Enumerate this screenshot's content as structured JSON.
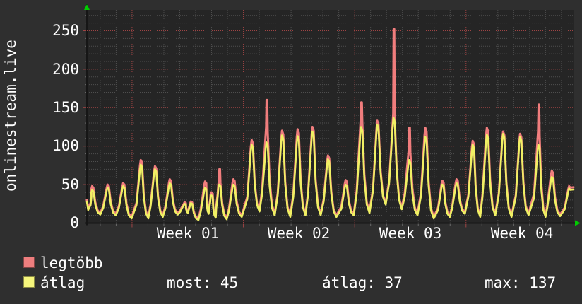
{
  "title": "onlinestream.live",
  "colors": {
    "background": "#2f2f2f",
    "plot_background": "#252525",
    "minor_grid": "#4f4f4f",
    "major_grid": "#a04444",
    "axis": "#161616",
    "arrow": "#00cc00",
    "text": "#ffffff",
    "series_max": "#f07d7d",
    "series_avg": "#f0f064",
    "swatch_max": "#ee7e7e",
    "swatch_avg": "#f6f67c"
  },
  "legend": [
    {
      "label": "legtöbb",
      "color": "#ee7e7e"
    },
    {
      "label": "átlag",
      "color": "#f6f67c"
    }
  ],
  "stats": [
    {
      "label": "most",
      "value": 45,
      "text": "most: 45"
    },
    {
      "label": "átlag",
      "value": 37,
      "text": "átlag: 37"
    },
    {
      "label": "max",
      "value": 137,
      "text": "max: 137"
    }
  ],
  "chart_data": {
    "type": "line",
    "title": "onlinestream.live",
    "grid": "dotted, minor gray every 10 units / 1 day, major red every 50 units / 1 week",
    "legend_position": "bottom-left",
    "x_axis": {
      "unit": "days",
      "span_days": 30.6,
      "tick_labels": [
        "Week 01",
        "Week 02",
        "Week 03",
        "Week 04"
      ],
      "tick_center_days": [
        6.34,
        13.34,
        20.34,
        27.34
      ],
      "week_boundary_days": [
        2.84,
        9.84,
        16.84,
        23.84
      ],
      "day_grid_start": 0.84
    },
    "y_axis": {
      "tick_labels": [
        "0",
        "50",
        "100",
        "150",
        "200",
        "250"
      ],
      "tick_values": [
        0,
        50,
        100,
        150,
        200,
        250
      ],
      "minor_step": 10,
      "ylim": [
        0,
        277
      ]
    },
    "series": [
      {
        "name": "legtöbb",
        "role": "daily maximum",
        "color": "#f07d7d"
      },
      {
        "name": "átlag",
        "role": "daily average",
        "color": "#f0f064"
      }
    ],
    "summary": {
      "most_current": 45,
      "atlag_average": 37,
      "max": 137
    },
    "start": {
      "max": 30,
      "avg": 28,
      "dip_max": 19,
      "dip_avg": 17
    },
    "days": [
      {
        "d": 0.36,
        "max": 48,
        "avg": 43,
        "lo": 13
      },
      {
        "d": 1.33,
        "max": 50,
        "avg": 46,
        "lo": 12
      },
      {
        "d": 2.31,
        "max": 52,
        "avg": 48,
        "lo": 8
      },
      {
        "d": 3.42,
        "max": 82,
        "avg": 76,
        "lo": 8
      },
      {
        "d": 4.31,
        "max": 74,
        "avg": 70,
        "lo": 10
      },
      {
        "d": 5.24,
        "max": 57,
        "avg": 52,
        "lo": 13
      },
      {
        "d": 6.17,
        "max": 27,
        "avg": 25,
        "lo": 15
      },
      {
        "d": 6.57,
        "max": 28,
        "avg": 26,
        "lo": 6
      },
      {
        "d": 7.46,
        "max": 54,
        "avg": 46,
        "lo": 14
      },
      {
        "d": 7.86,
        "max": 40,
        "avg": 36,
        "lo": 9
      },
      {
        "d": 8.35,
        "max": 70,
        "avg": 50,
        "lo": 7,
        "step": 55
      },
      {
        "d": 9.24,
        "max": 57,
        "avg": 50,
        "lo": 10
      },
      {
        "d": 10.39,
        "max": 108,
        "avg": 102,
        "lo": 17
      },
      {
        "d": 11.32,
        "max": 160,
        "avg": 105,
        "lo": 12,
        "step": 125
      },
      {
        "d": 12.3,
        "max": 120,
        "avg": 114,
        "lo": 10
      },
      {
        "d": 13.28,
        "max": 122,
        "avg": 113,
        "lo": 12
      },
      {
        "d": 14.21,
        "max": 125,
        "avg": 119,
        "lo": 12
      },
      {
        "d": 15.19,
        "max": 88,
        "avg": 83,
        "lo": 10
      },
      {
        "d": 16.3,
        "max": 56,
        "avg": 50,
        "lo": 12
      },
      {
        "d": 17.27,
        "max": 157,
        "avg": 125,
        "lo": 15,
        "step": 137
      },
      {
        "d": 18.29,
        "max": 133,
        "avg": 128,
        "lo": 26
      },
      {
        "d": 19.31,
        "max": 252,
        "avg": 137,
        "lo": 20,
        "step": 143
      },
      {
        "d": 20.29,
        "max": 124,
        "avg": 82,
        "lo": 12,
        "step": 97
      },
      {
        "d": 21.31,
        "max": 124,
        "avg": 112,
        "lo": 8
      },
      {
        "d": 22.38,
        "max": 55,
        "avg": 50,
        "lo": 10
      },
      {
        "d": 23.27,
        "max": 57,
        "avg": 52,
        "lo": 14
      },
      {
        "d": 24.29,
        "max": 107,
        "avg": 102,
        "lo": 10
      },
      {
        "d": 25.18,
        "max": 124,
        "avg": 115,
        "lo": 12
      },
      {
        "d": 26.2,
        "max": 119,
        "avg": 116,
        "lo": 10
      },
      {
        "d": 27.27,
        "max": 116,
        "avg": 112,
        "lo": 12
      },
      {
        "d": 28.42,
        "max": 154,
        "avg": 102,
        "lo": 10,
        "step": 119
      },
      {
        "d": 29.26,
        "max": 68,
        "avg": 60,
        "lo": 11
      },
      {
        "d": 30.35,
        "max": 48,
        "avg": 45,
        "lo": 45,
        "end": true
      }
    ]
  }
}
